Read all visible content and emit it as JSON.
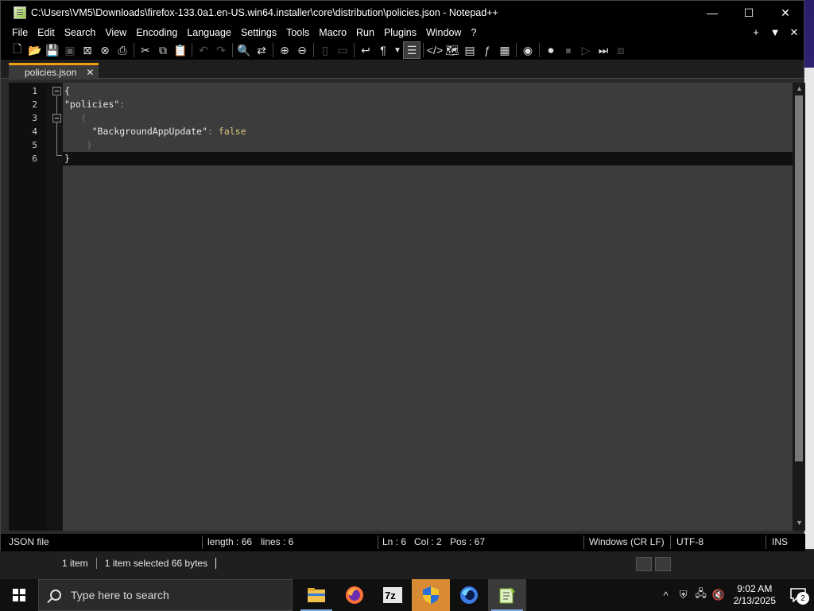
{
  "window": {
    "title": "C:\\Users\\VM5\\Downloads\\firefox-133.0a1.en-US.win64.installer\\core\\distribution\\policies.json - Notepad++",
    "minimize": "—",
    "maximize": "☐",
    "close": "✕"
  },
  "menu": {
    "items": [
      "File",
      "Edit",
      "Search",
      "View",
      "Encoding",
      "Language",
      "Settings",
      "Tools",
      "Macro",
      "Run",
      "Plugins",
      "Window",
      "?"
    ],
    "right": [
      "+",
      "▼",
      "✕"
    ]
  },
  "tab": {
    "label": "policies.json",
    "close": "✕"
  },
  "editor": {
    "line_numbers": [
      "1",
      "2",
      "3",
      "4",
      "5",
      "6"
    ],
    "lines": [
      {
        "text": "{"
      },
      {
        "key": "\"policies\"",
        "colon": ":"
      },
      {
        "text": "{"
      },
      {
        "key": "\"BackgroundAppUpdate\"",
        "colon": ":",
        "value": "false"
      },
      {
        "text": "}"
      },
      {
        "text": "}"
      }
    ]
  },
  "status": {
    "filetype": "JSON file",
    "length": "length : 66",
    "lines": "lines : 6",
    "ln": "Ln : 6",
    "col": "Col : 2",
    "pos": "Pos : 67",
    "eol": "Windows (CR LF)",
    "encoding": "UTF-8",
    "mode": "INS"
  },
  "explorer_status": {
    "items": "1 item",
    "selected": "1 item selected  66 bytes"
  },
  "taskbar": {
    "search_placeholder": "Type here to search",
    "apps": [
      "file-explorer-icon",
      "firefox-icon",
      "7zip-icon",
      "shield-icon",
      "firefox-dev-icon",
      "notepadpp-icon"
    ],
    "time": "9:02 AM",
    "date": "2/13/2025",
    "notifications": "2"
  },
  "colors": {
    "accent_tab": "#f39c12",
    "keyword": "#d7c27a",
    "background": "#3c3c3c"
  }
}
